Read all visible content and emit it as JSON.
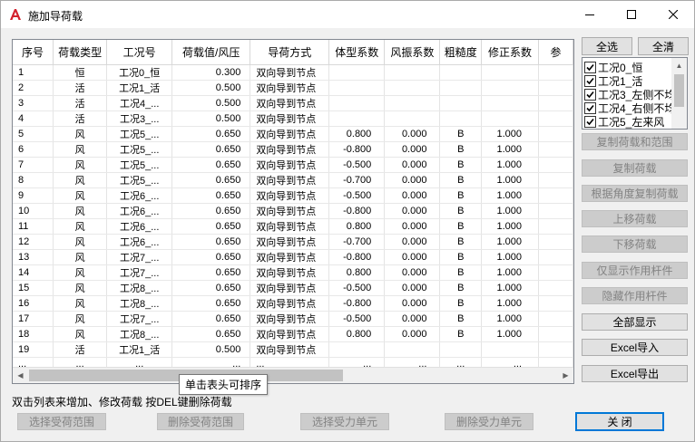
{
  "window": {
    "title": "施加导荷载",
    "min_icon": "minimize-icon",
    "max_icon": "maximize-icon",
    "close_icon": "close-icon",
    "app_icon": "autocad-logo-icon"
  },
  "grid": {
    "columns": [
      "序号",
      "荷载类型",
      "工况号",
      "荷载值/风压",
      "导荷方式",
      "体型系数",
      "风振系数",
      "粗糙度",
      "修正系数",
      "参"
    ],
    "rows": [
      [
        "1",
        "恒",
        "工况0_恒",
        "0.300",
        "双向导到节点",
        "",
        "",
        "",
        ""
      ],
      [
        "2",
        "活",
        "工况1_活",
        "0.500",
        "双向导到节点",
        "",
        "",
        "",
        ""
      ],
      [
        "3",
        "活",
        "工况4_...",
        "0.500",
        "双向导到节点",
        "",
        "",
        "",
        ""
      ],
      [
        "4",
        "活",
        "工况3_...",
        "0.500",
        "双向导到节点",
        "",
        "",
        "",
        ""
      ],
      [
        "5",
        "风",
        "工况5_...",
        "0.650",
        "双向导到节点",
        "0.800",
        "0.000",
        "B",
        "1.000"
      ],
      [
        "6",
        "风",
        "工况5_...",
        "0.650",
        "双向导到节点",
        "-0.800",
        "0.000",
        "B",
        "1.000"
      ],
      [
        "7",
        "风",
        "工况5_...",
        "0.650",
        "双向导到节点",
        "-0.500",
        "0.000",
        "B",
        "1.000"
      ],
      [
        "8",
        "风",
        "工况5_...",
        "0.650",
        "双向导到节点",
        "-0.700",
        "0.000",
        "B",
        "1.000"
      ],
      [
        "9",
        "风",
        "工况6_...",
        "0.650",
        "双向导到节点",
        "-0.500",
        "0.000",
        "B",
        "1.000"
      ],
      [
        "10",
        "风",
        "工况6_...",
        "0.650",
        "双向导到节点",
        "-0.800",
        "0.000",
        "B",
        "1.000"
      ],
      [
        "11",
        "风",
        "工况6_...",
        "0.650",
        "双向导到节点",
        "0.800",
        "0.000",
        "B",
        "1.000"
      ],
      [
        "12",
        "风",
        "工况6_...",
        "0.650",
        "双向导到节点",
        "-0.700",
        "0.000",
        "B",
        "1.000"
      ],
      [
        "13",
        "风",
        "工况7_...",
        "0.650",
        "双向导到节点",
        "-0.800",
        "0.000",
        "B",
        "1.000"
      ],
      [
        "14",
        "风",
        "工况7_...",
        "0.650",
        "双向导到节点",
        "0.800",
        "0.000",
        "B",
        "1.000"
      ],
      [
        "15",
        "风",
        "工况8_...",
        "0.650",
        "双向导到节点",
        "-0.500",
        "0.000",
        "B",
        "1.000"
      ],
      [
        "16",
        "风",
        "工况8_...",
        "0.650",
        "双向导到节点",
        "-0.800",
        "0.000",
        "B",
        "1.000"
      ],
      [
        "17",
        "风",
        "工况7_...",
        "0.650",
        "双向导到节点",
        "-0.500",
        "0.000",
        "B",
        "1.000"
      ],
      [
        "18",
        "风",
        "工况8_...",
        "0.650",
        "双向导到节点",
        "0.800",
        "0.000",
        "B",
        "1.000"
      ],
      [
        "19",
        "活",
        "工况1_活",
        "0.500",
        "双向导到节点",
        "",
        "",
        "",
        ""
      ],
      [
        "...",
        "...",
        "...",
        "...",
        "...",
        "...",
        "...",
        "...",
        "..."
      ]
    ],
    "tooltip": "单击表头可排序",
    "scroll_left_icon": "scroll-left-icon",
    "scroll_right_icon": "scroll-right-icon"
  },
  "side": {
    "select_all": "全选",
    "clear_all": "全清",
    "cases": [
      {
        "label": "工况0_恒",
        "checked": true
      },
      {
        "label": "工况1_活",
        "checked": true
      },
      {
        "label": "工况3_左侧不均",
        "checked": true
      },
      {
        "label": "工况4_右侧不均",
        "checked": true
      },
      {
        "label": "工况5_左来风",
        "checked": true
      }
    ],
    "buttons": [
      {
        "label": "复制荷载和范围",
        "enabled": false
      },
      {
        "label": "复制荷载",
        "enabled": false
      },
      {
        "label": "根据角度复制荷载",
        "enabled": false
      },
      {
        "label": "上移荷载",
        "enabled": false
      },
      {
        "label": "下移荷载",
        "enabled": false
      },
      {
        "label": "仅显示作用杆件",
        "enabled": false
      },
      {
        "label": "隐藏作用杆件",
        "enabled": false
      },
      {
        "label": "全部显示",
        "enabled": true
      },
      {
        "label": "Excel导入",
        "enabled": true
      },
      {
        "label": "Excel导出",
        "enabled": true
      }
    ]
  },
  "footer": {
    "hint": "双击列表来增加、修改荷载    按DEL键删除荷载",
    "select_range": "选择受荷范围",
    "delete_range": "删除受荷范围",
    "select_unit": "选择受力单元",
    "delete_unit": "删除受力单元",
    "close": "关    闭"
  },
  "colors": {
    "focus_border": "#0078d7",
    "logo_red": "#d3212d"
  }
}
